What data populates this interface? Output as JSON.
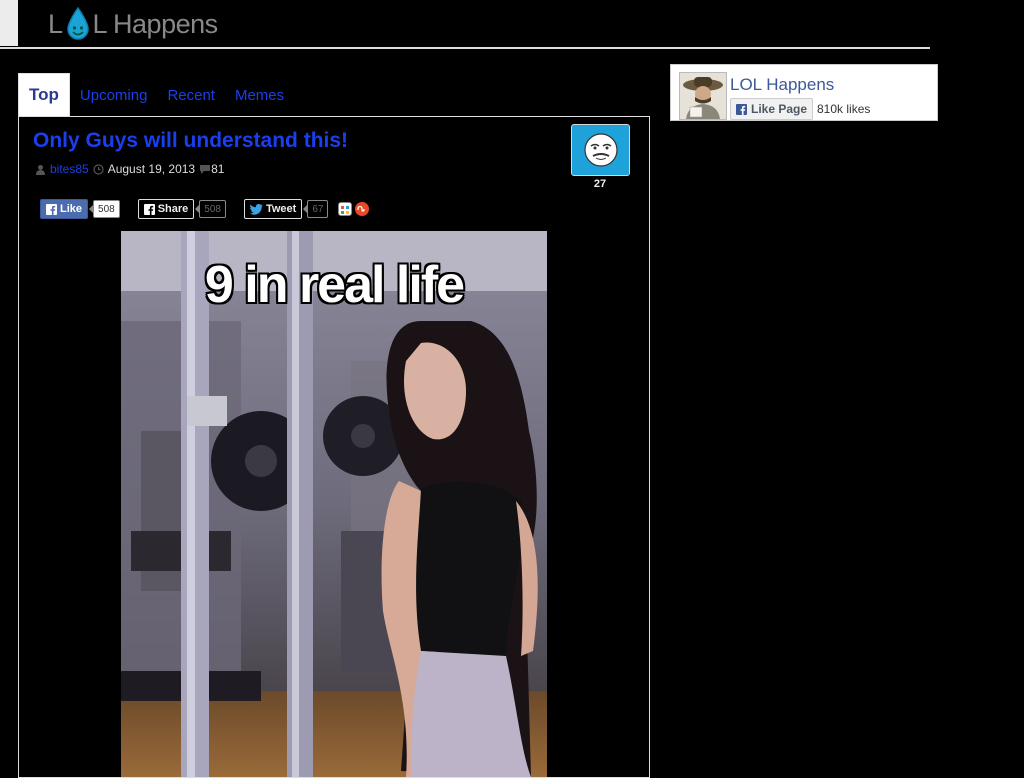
{
  "header": {
    "logo_text_left": "L",
    "logo_text_right": "L Happens"
  },
  "tabs": [
    {
      "label": "Top"
    },
    {
      "label": "Upcoming"
    },
    {
      "label": "Recent"
    },
    {
      "label": "Memes"
    }
  ],
  "post": {
    "title": "Only Guys will understand this!",
    "author": "bites85",
    "date": "August 19, 2013",
    "comments": "81",
    "vote_count": "27",
    "image_caption": "9 in real life"
  },
  "share": {
    "like_label": "Like",
    "like_count": "508",
    "share_label": "Share",
    "share_count": "508",
    "tweet_label": "Tweet",
    "tweet_count": "67"
  },
  "facebook_widget": {
    "page_name": "LOL Happens",
    "like_button_label": "Like Page",
    "likes_count": "810k likes"
  },
  "colors": {
    "link_blue": "#1a3ff0",
    "vote_blue": "#1fa2d9",
    "facebook_blue": "#3b5998"
  },
  "icons": [
    "drop-logo-icon",
    "user-icon",
    "clock-icon",
    "comment-icon",
    "facebook-icon",
    "twitter-icon",
    "meme-face-icon",
    "stumbleupon-icon"
  ]
}
